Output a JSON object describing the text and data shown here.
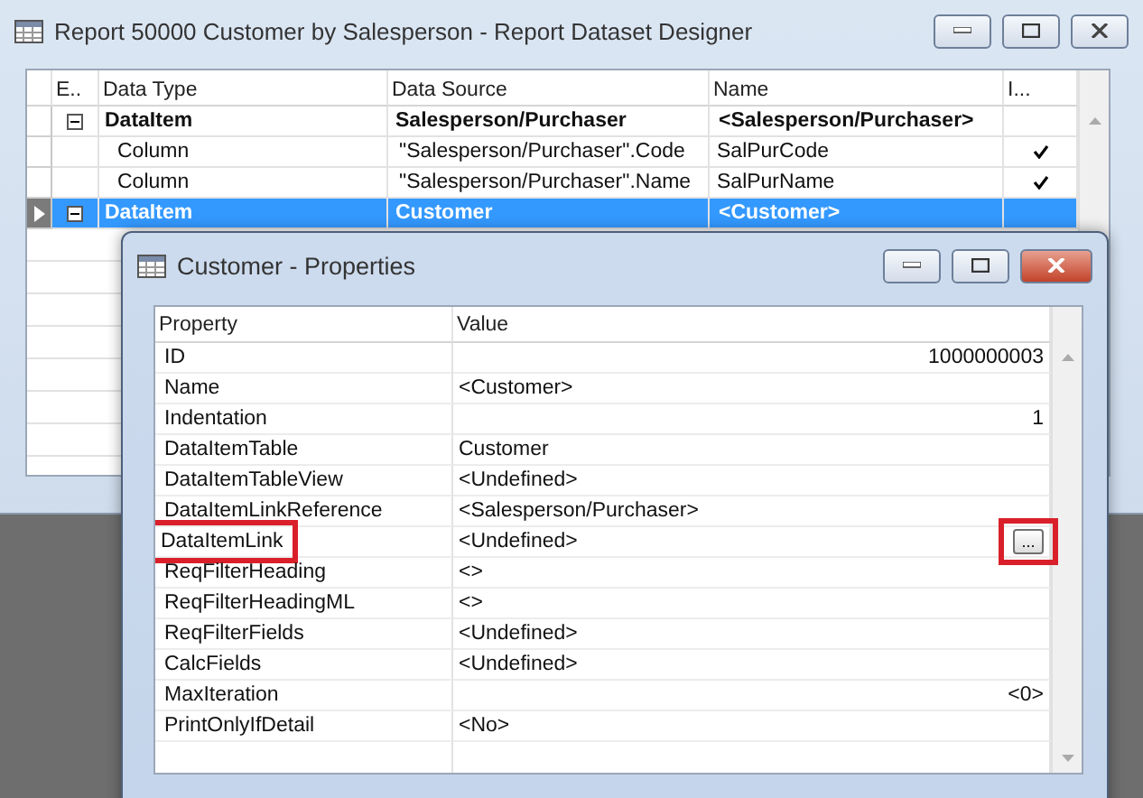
{
  "window": {
    "title": "Report 50000 Customer by Salesperson - Report Dataset Designer"
  },
  "table": {
    "columns": [
      "E..",
      "Data Type",
      "Data Source",
      "Name",
      "I..."
    ],
    "rows": [
      {
        "kind": "dataitem",
        "expanded": true,
        "selected": false,
        "data_type": "DataItem",
        "data_source": "Salesperson/Purchaser",
        "name": "<Salesperson/Purchaser>",
        "include": false
      },
      {
        "kind": "column",
        "selected": false,
        "data_type": "Column",
        "data_source": "\"Salesperson/Purchaser\".Code",
        "name": "SalPurCode",
        "include": true
      },
      {
        "kind": "column",
        "selected": false,
        "data_type": "Column",
        "data_source": "\"Salesperson/Purchaser\".Name",
        "name": "SalPurName",
        "include": true
      },
      {
        "kind": "dataitem",
        "expanded": true,
        "selected": true,
        "data_type": "DataItem",
        "data_source": "Customer",
        "name": "<Customer>",
        "include": false
      }
    ]
  },
  "dialog": {
    "title": "Customer - Properties",
    "columns": [
      "Property",
      "Value"
    ],
    "properties": [
      {
        "name": "ID",
        "value": "1000000003",
        "kind": "number",
        "highlighted": false
      },
      {
        "name": "Name",
        "value": "<Customer>",
        "kind": "text",
        "highlighted": false
      },
      {
        "name": "Indentation",
        "value": "1",
        "kind": "number",
        "highlighted": false
      },
      {
        "name": "DataItemTable",
        "value": "Customer",
        "kind": "text",
        "highlighted": false
      },
      {
        "name": "DataItemTableView",
        "value": "<Undefined>",
        "kind": "text",
        "highlighted": false
      },
      {
        "name": "DataItemLinkReference",
        "value": "<Salesperson/Purchaser>",
        "kind": "text",
        "highlighted": false
      },
      {
        "name": "DataItemLink",
        "value": "<Undefined>",
        "kind": "text",
        "highlighted": true,
        "assist_button": {
          "label": "...",
          "highlighted": true
        }
      },
      {
        "name": "ReqFilterHeading",
        "value": "<>",
        "kind": "text",
        "highlighted": false
      },
      {
        "name": "ReqFilterHeadingML",
        "value": "<>",
        "kind": "text",
        "highlighted": false
      },
      {
        "name": "ReqFilterFields",
        "value": "<Undefined>",
        "kind": "text",
        "highlighted": false
      },
      {
        "name": "CalcFields",
        "value": "<Undefined>",
        "kind": "text",
        "highlighted": false
      },
      {
        "name": "MaxIteration",
        "value": "<0>",
        "kind": "number",
        "highlighted": false
      },
      {
        "name": "PrintOnlyIfDetail",
        "value": "<No>",
        "kind": "text",
        "highlighted": false
      }
    ]
  }
}
